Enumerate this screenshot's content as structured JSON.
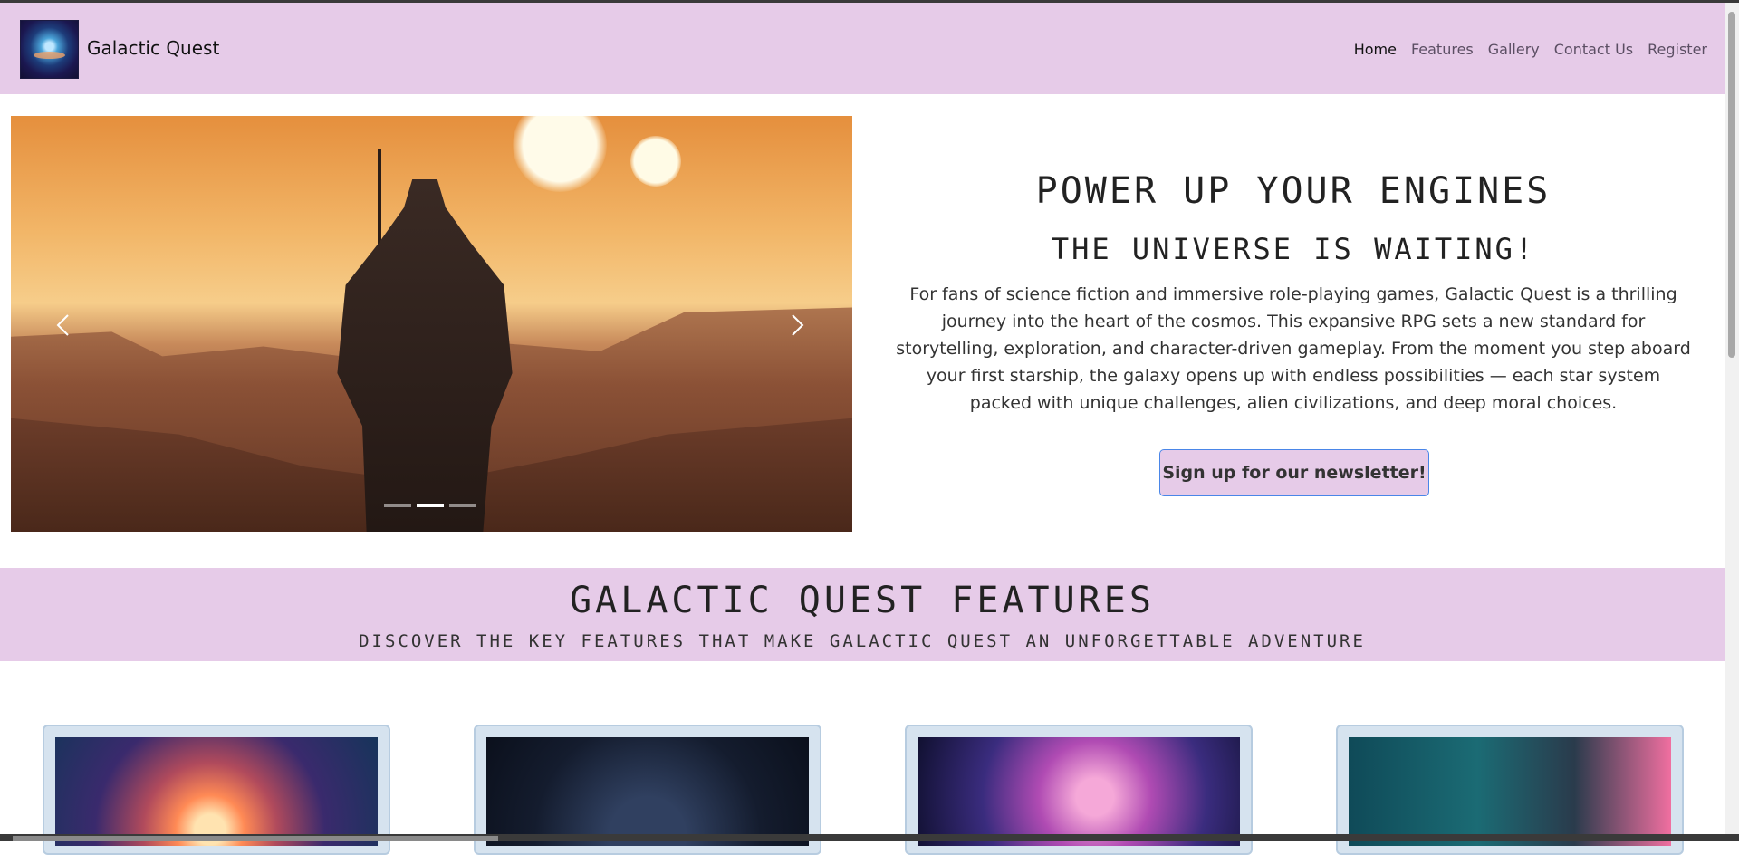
{
  "brand": {
    "name": "Galactic Quest"
  },
  "nav": {
    "items": [
      "Home",
      "Features",
      "Gallery",
      "Contact Us",
      "Register"
    ],
    "active": "Home"
  },
  "carousel": {
    "prev_icon": "chevron-left-icon",
    "next_icon": "chevron-right-icon",
    "slide_count": 3,
    "active_slide": 2
  },
  "hero": {
    "title": "POWER UP YOUR ENGINES",
    "subtitle": "THE UNIVERSE IS WAITING!",
    "description": "For fans of science fiction and immersive role-playing games, Galactic Quest is a thrilling journey into the heart of the cosmos. This expansive RPG sets a new standard for storytelling, exploration, and character-driven gameplay. From the moment you step aboard your first starship, the galaxy opens up with endless possibilities — each star system packed with unique challenges, alien civilizations, and deep moral choices.",
    "cta_label": "Sign up for our newsletter!"
  },
  "features": {
    "title": "GALACTIC QUEST FEATURES",
    "subtitle": "DISCOVER THE KEY FEATURES THAT MAKE GALACTIC QUEST AN UNFORGETTABLE ADVENTURE"
  },
  "colors": {
    "accent": "#e6cbe8",
    "cta_border": "#4a86e8",
    "card_bg": "#d6e3ef"
  }
}
